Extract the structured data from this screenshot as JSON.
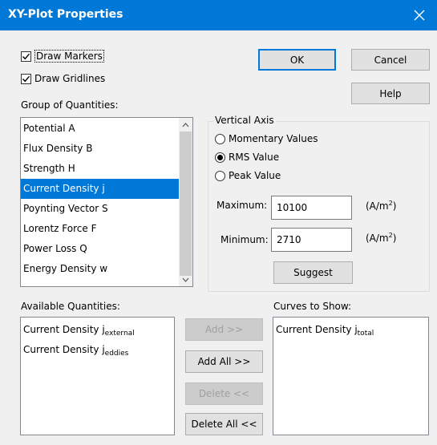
{
  "window": {
    "title": "XY-Plot Properties"
  },
  "options": {
    "draw_markers": {
      "label": "Draw Markers",
      "checked": true
    },
    "draw_gridlines": {
      "label": "Draw Gridlines",
      "checked": true
    }
  },
  "buttons": {
    "ok": "OK",
    "cancel": "Cancel",
    "help": "Help",
    "suggest": "Suggest",
    "add": "Add >>",
    "add_all": "Add All >>",
    "delete": "Delete <<",
    "delete_all": "Delete All <<"
  },
  "group_of_quantities": {
    "label": "Group of Quantities:",
    "items": [
      "Potential A",
      "Flux Density B",
      "Strength H",
      "Current Density j",
      "Poynting Vector S",
      "Lorentz Force F",
      "Power Loss Q",
      "Energy Density w"
    ],
    "selected": "Current Density j"
  },
  "vertical_axis": {
    "label": "Vertical Axis",
    "options": [
      "Momentary Values",
      "RMS Value",
      "Peak Value"
    ],
    "selected": "RMS Value",
    "maximum": {
      "label": "Maximum:",
      "value": "10100",
      "unit": "(A/m",
      "unit_exp": "2",
      "unit_close": ")"
    },
    "minimum": {
      "label": "Minimum:",
      "value": "2710",
      "unit": "(A/m",
      "unit_exp": "2",
      "unit_close": ")"
    }
  },
  "available_quantities": {
    "label": "Available Quantities:",
    "items": [
      {
        "base": "Current Density j",
        "sub": "external"
      },
      {
        "base": "Current Density j",
        "sub": "eddies"
      }
    ]
  },
  "curves_to_show": {
    "label": "Curves to Show:",
    "items": [
      {
        "base": "Current Density j",
        "sub": "total"
      }
    ]
  },
  "colors": {
    "titlebar": "#0078d7",
    "selection": "#0078d7",
    "dialog_bg": "#f0f0f0"
  }
}
